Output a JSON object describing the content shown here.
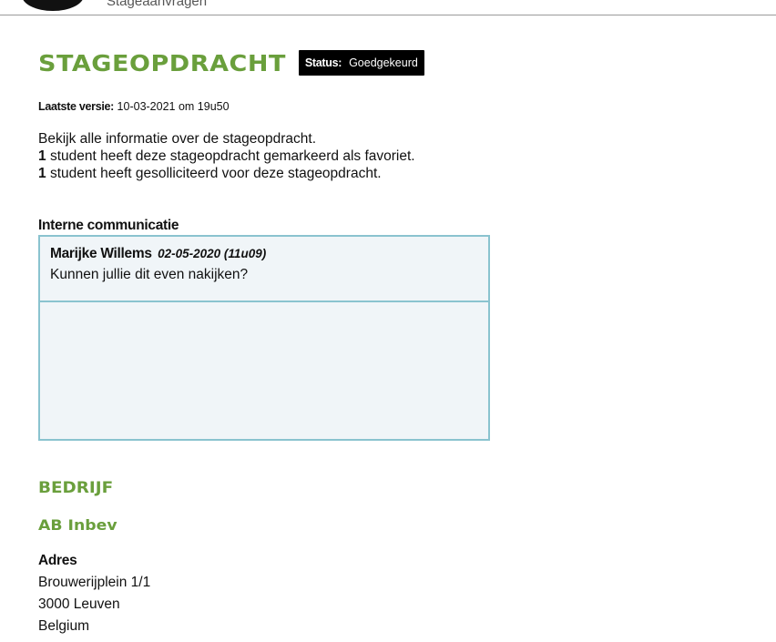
{
  "nav": {
    "partial_item": "Stageaanvragen"
  },
  "page": {
    "title": "STAGEOPDRACHT",
    "status_label": "Status:",
    "status_value": "Goedgekeurd",
    "version_label": "Laatste versie:",
    "version_value": "10-03-2021 om 19u50"
  },
  "intro": {
    "line1": "Bekijk alle informatie over de stageopdracht.",
    "favorites_count": "1",
    "favorites_text": "student heeft deze stageopdracht gemarkeerd als favoriet.",
    "applications_count": "1",
    "applications_text": "student heeft gesolliciteerd voor deze stageopdracht."
  },
  "communication": {
    "heading": "Interne communicatie",
    "messages": [
      {
        "author": "Marijke Willems",
        "date": "02-05-2020 (11u09)",
        "text": "Kunnen jullie dit even nakijken?"
      }
    ]
  },
  "company": {
    "section_title": "BEDRIJF",
    "name": "AB Inbev",
    "address_label": "Adres",
    "address_lines": [
      "Brouwerijplein 1/1",
      "3000 Leuven",
      "Belgium"
    ]
  },
  "colors": {
    "accent_green": "#6a9f3c",
    "comm_border": "#8ac3cf",
    "comm_background": "#f0f5f8",
    "badge_background": "#000000"
  }
}
